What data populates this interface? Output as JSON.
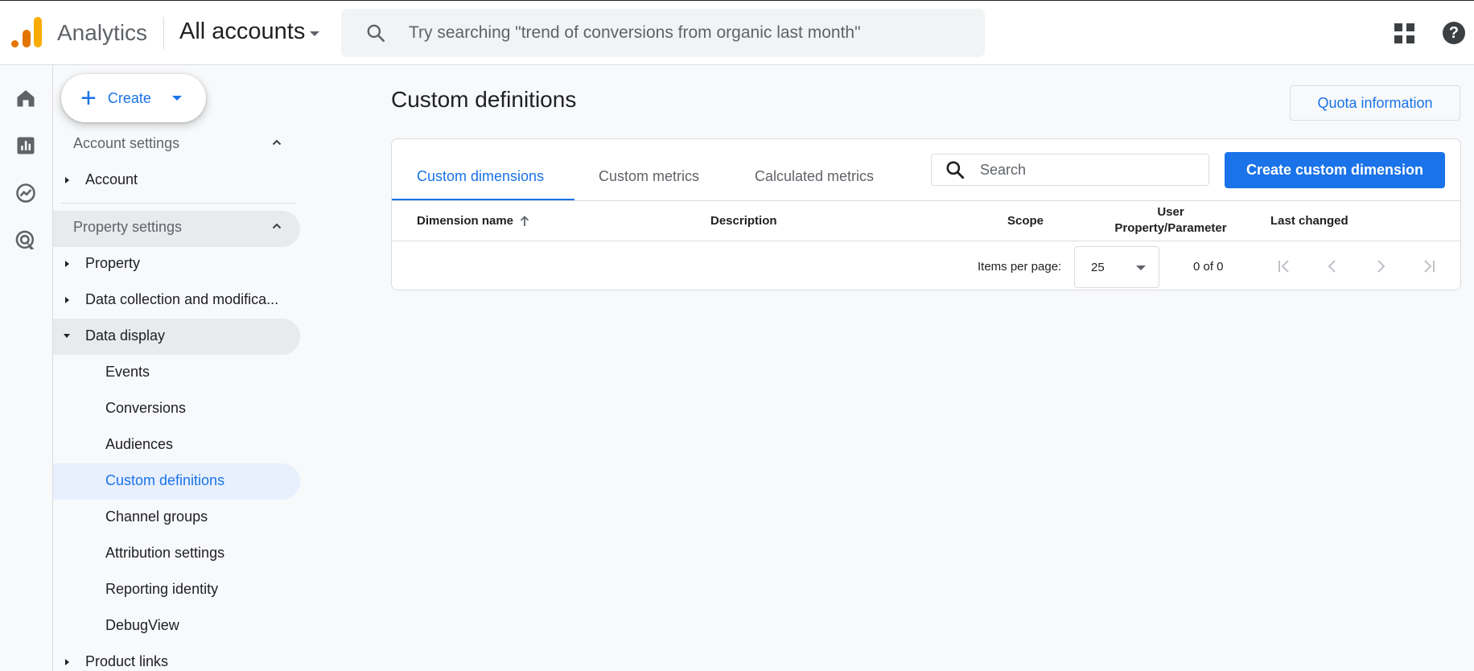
{
  "header": {
    "app_name": "Analytics",
    "account_picker": "All accounts",
    "search_placeholder": "Try searching \"trend of conversions from organic last month\""
  },
  "rail": {
    "items": [
      "home-icon",
      "reports-icon",
      "explore-icon",
      "advertising-icon"
    ]
  },
  "sidenav": {
    "create_label": "Create",
    "account_settings": {
      "title": "Account settings",
      "items": [
        "Account"
      ]
    },
    "property_settings": {
      "title": "Property settings",
      "items": {
        "property": "Property",
        "data_collection": "Data collection and modifica...",
        "data_display": "Data display",
        "product_links": "Product links"
      },
      "data_display_children": [
        "Events",
        "Conversions",
        "Audiences",
        "Custom definitions",
        "Channel groups",
        "Attribution settings",
        "Reporting identity",
        "DebugView"
      ],
      "selected": "Custom definitions"
    }
  },
  "main": {
    "title": "Custom definitions",
    "quota_button": "Quota information",
    "tabs": [
      "Custom dimensions",
      "Custom metrics",
      "Calculated metrics"
    ],
    "active_tab": "Custom dimensions",
    "search_placeholder": "Search",
    "create_button": "Create custom dimension",
    "columns": {
      "dimension_name": "Dimension name",
      "description": "Description",
      "scope": "Scope",
      "user_property_line1": "User",
      "user_property_line2": "Property/Parameter",
      "last_changed": "Last changed"
    },
    "sort": "ascending",
    "pagination": {
      "items_per_page_label": "Items per page:",
      "items_per_page": "25",
      "range": "0 of 0"
    }
  },
  "colors": {
    "accent": "#1a73e8",
    "selected_bg": "#e8f0fe",
    "hover_bg": "#e8eaed",
    "logo_orange": "#e37400",
    "logo_yellow": "#f9ab00"
  }
}
